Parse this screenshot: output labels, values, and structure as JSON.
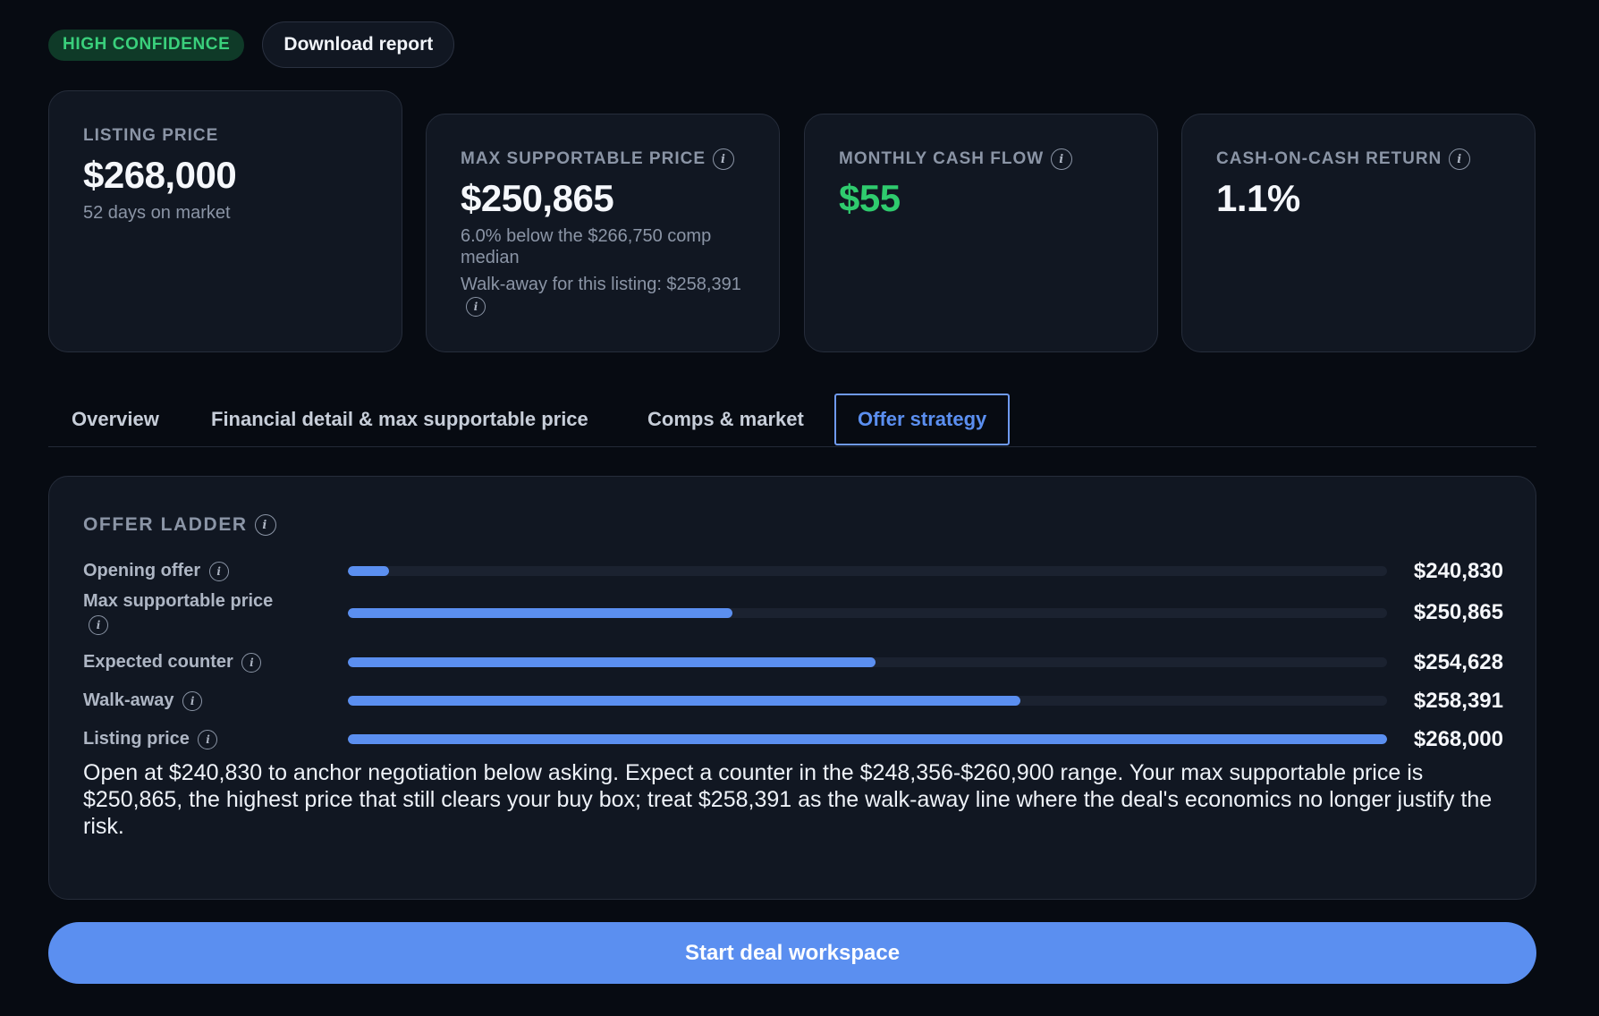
{
  "header": {
    "confidence_badge": "HIGH CONFIDENCE",
    "download_label": "Download report"
  },
  "cards": {
    "listing": {
      "label": "LISTING PRICE",
      "value": "$268,000",
      "sub": "52 days on market"
    },
    "max_supportable": {
      "label": "MAX SUPPORTABLE PRICE",
      "value": "$250,865",
      "sub": "6.0% below the $266,750 comp median",
      "walkaway": "Walk-away for this listing: $258,391"
    },
    "cash_flow": {
      "label": "MONTHLY CASH FLOW",
      "value": "$55",
      "value_color": "#2fcb6e"
    },
    "coc_return": {
      "label": "CASH-ON-CASH RETURN",
      "value": "1.1%"
    }
  },
  "tabs": [
    {
      "label": "Overview",
      "active": false
    },
    {
      "label": "Financial detail & max supportable price",
      "active": false
    },
    {
      "label": "Comps & market",
      "active": false
    },
    {
      "label": "Offer strategy",
      "active": true
    }
  ],
  "offer_ladder": {
    "title": "OFFER LADDER",
    "rows": [
      {
        "label": "Opening offer",
        "value": "$240,830",
        "fill_fraction": 0.04
      },
      {
        "label": "Max supportable price",
        "value": "$250,865",
        "fill_fraction": 0.37
      },
      {
        "label": "Expected counter",
        "value": "$254,628",
        "fill_fraction": 0.508
      },
      {
        "label": "Walk-away",
        "value": "$258,391",
        "fill_fraction": 0.647
      },
      {
        "label": "Listing price",
        "value": "$268,000",
        "fill_fraction": 1.0
      }
    ],
    "summary": "Open at $240,830 to anchor negotiation below asking. Expect a counter in the $248,356-$260,900 range. Your max supportable price is $250,865, the highest price that still clears your buy box; treat $258,391 as the walk-away line where the deal's economics no longer justify the risk."
  },
  "cta_label": "Start deal workspace",
  "colors": {
    "accent": "#5b8ff0",
    "positive": "#2fcb6e",
    "badge_bg": "#0f3a28"
  },
  "icons": {
    "info": "info-icon"
  }
}
